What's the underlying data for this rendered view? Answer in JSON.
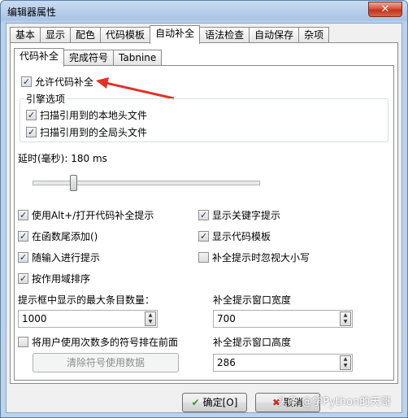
{
  "window": {
    "title": "编辑器属性",
    "close_label": "✕"
  },
  "tabs": [
    {
      "label": "基本"
    },
    {
      "label": "显示"
    },
    {
      "label": "配色"
    },
    {
      "label": "代码模板"
    },
    {
      "label": "自动补全",
      "active": true
    },
    {
      "label": "语法检查"
    },
    {
      "label": "自动保存"
    },
    {
      "label": "杂项"
    }
  ],
  "sub_tabs": [
    {
      "label": "代码补全",
      "active": true
    },
    {
      "label": "完成符号"
    },
    {
      "label": "Tabnine"
    }
  ],
  "allow_completion": {
    "label": "允许代码补全",
    "checked": true
  },
  "engine": {
    "title": "引擎选项",
    "options": [
      {
        "label": "扫描引用到的本地头文件",
        "checked": true
      },
      {
        "label": "扫描引用到的全局头文件",
        "checked": true
      }
    ]
  },
  "delay": {
    "label": "延时(毫秒): 180 ms",
    "value": 180,
    "min": 0,
    "max": 1000
  },
  "left_options": [
    {
      "label": "使用Alt+/打开代码补全提示",
      "checked": true
    },
    {
      "label": "在函数尾添加()",
      "checked": true
    },
    {
      "label": "随输入进行提示",
      "checked": true
    },
    {
      "label": "按作用域排序",
      "checked": true
    }
  ],
  "right_options": [
    {
      "label": "显示关键字提示",
      "checked": true
    },
    {
      "label": "显示代码模板",
      "checked": true
    },
    {
      "label": "补全提示时忽视大小写",
      "checked": false
    }
  ],
  "max_items": {
    "label": "提示框中显示的最大条目数量：",
    "value": "1000"
  },
  "popup_width": {
    "label": "补全提示窗口宽度",
    "value": "700"
  },
  "popup_height": {
    "label": "补全提示窗口高度",
    "value": "286"
  },
  "frequent_symbols": {
    "label": "将用户使用次数多的符号排在前面",
    "checked": false
  },
  "clear_button": {
    "label": "清除符号使用数据"
  },
  "ok_button": {
    "label": "确定[O]"
  },
  "cancel_button": {
    "label": "取消"
  },
  "watermark": "头条 @学Python的天哥",
  "colors": {
    "arrow": "#e0332a",
    "ok_icon": "#2e9b2e",
    "cancel_icon": "#cc2a2a"
  }
}
